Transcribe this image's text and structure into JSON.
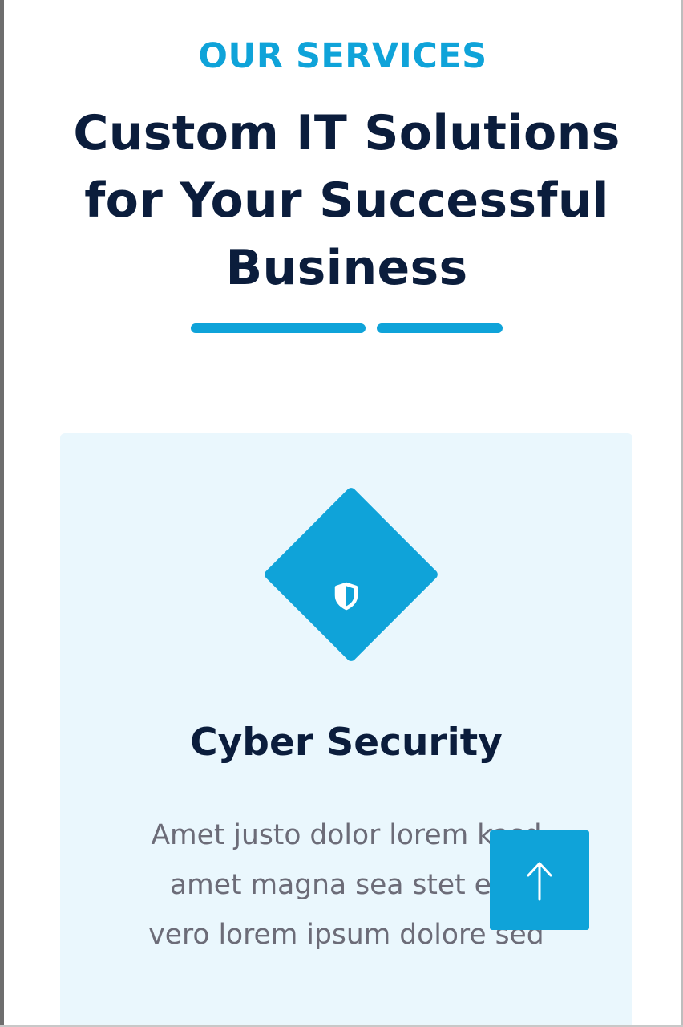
{
  "section": {
    "eyebrow": "OUR SERVICES",
    "title_lines": [
      "Custom IT Solutions",
      "for Your Successful",
      "Business"
    ]
  },
  "service_card": {
    "icon": "shield-icon",
    "title": "Cyber Security",
    "description_lines": [
      "Amet justo dolor lorem kasd",
      "amet magna sea stet eos",
      "vero lorem ipsum dolore sed"
    ]
  },
  "back_to_top": {
    "icon": "arrow-up-icon"
  },
  "colors": {
    "accent": "#0fa3d9",
    "heading": "#0b1d3c",
    "card_background": "#eaf7fd",
    "body_text": "#6c6c78"
  }
}
